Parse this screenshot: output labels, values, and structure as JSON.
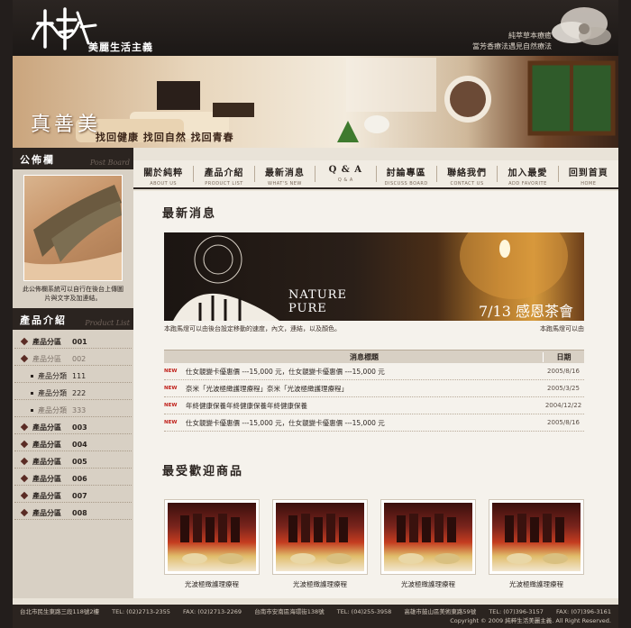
{
  "brand": {
    "logo_name": "純粹",
    "tagline": "美麗生活主義",
    "slogan_1": "純萃草本療癒",
    "slogan_2": "當芳香療法遇見自然療法"
  },
  "banner": {
    "title": "真善美",
    "subtitle": "找回健康 找回自然 找回青春"
  },
  "nav": [
    {
      "zh": "關於純粹",
      "en": "ABOUT US"
    },
    {
      "zh": "產品介紹",
      "en": "PRODUCT LIST"
    },
    {
      "zh": "最新消息",
      "en": "WHAT'S NEW"
    },
    {
      "zh": "Q & A",
      "en": "Q & A"
    },
    {
      "zh": "討論專區",
      "en": "DISCUSS BOARD"
    },
    {
      "zh": "聯絡我們",
      "en": "CONTACT US"
    },
    {
      "zh": "加入最愛",
      "en": "ADD FAVORITE"
    },
    {
      "zh": "回到首頁",
      "en": "HOME"
    }
  ],
  "sidebar": {
    "notice_title": "公佈欄",
    "notice_title_en": "Post Board",
    "notice_text": "此公佈欄系統可以自行在後台上傳圖片與文字及加連結。",
    "products_title": "產品介紹",
    "products_title_en": "Product List",
    "categories": [
      {
        "label": "產品分區",
        "num": "001",
        "type": "main"
      },
      {
        "label": "產品分區",
        "num": "002",
        "type": "dim"
      },
      {
        "label": "產品分類",
        "num": "111",
        "type": "sub"
      },
      {
        "label": "產品分類",
        "num": "222",
        "type": "sub"
      },
      {
        "label": "產品分類",
        "num": "333",
        "type": "subdim"
      },
      {
        "label": "產品分區",
        "num": "003",
        "type": "main"
      },
      {
        "label": "產品分區",
        "num": "004",
        "type": "main"
      },
      {
        "label": "產品分區",
        "num": "005",
        "type": "main"
      },
      {
        "label": "產品分區",
        "num": "006",
        "type": "main"
      },
      {
        "label": "產品分區",
        "num": "007",
        "type": "main"
      },
      {
        "label": "產品分區",
        "num": "008",
        "type": "main"
      }
    ]
  },
  "main": {
    "news_title": "最新消息",
    "promo_en_1": "NATURE",
    "promo_en_2": "PURE",
    "promo_zh": "7/13 感恩茶會",
    "marquee_left": "本跑馬燈可以由後台設定移動的速度，內文，連結，以及顏色。",
    "marquee_right": "本跑馬燈可以由",
    "table_head_title": "消息標題",
    "table_head_date": "日期",
    "new_badge": "NEW",
    "news": [
      {
        "title": "仕女靚變卡優惠價 ---15,000 元，仕女靚變卡優惠價 ---15,000 元",
        "date": "2005/8/16"
      },
      {
        "title": "奈米「光波極緻護理療程」奈米「光波極緻護理療程」",
        "date": "2005/3/25"
      },
      {
        "title": "年終健康保養年終健康保養年終健康保養",
        "date": "2004/12/22"
      },
      {
        "title": "仕女靚變卡優惠價 ---15,000 元，仕女靚變卡優惠價 ---15,000 元",
        "date": "2005/8/16"
      }
    ],
    "fav_title": "最受歡迎商品",
    "products": [
      {
        "name": "光波極緻護理療程"
      },
      {
        "name": "光波極緻護理療程"
      },
      {
        "name": "光波極緻護理療程"
      },
      {
        "name": "光波極緻護理療程"
      }
    ]
  },
  "footer": {
    "addr_1": "台北市民生東路三段118號2樓",
    "tel_1": "TEL: (02)2713-2355",
    "fax_1": "FAX: (02)2713-2269",
    "addr_2": "台南市安南區海環街138號",
    "tel_2": "TEL: (04)255-3958",
    "addr_3": "高雄市鼓山區美術東路59號",
    "tel_3": "TEL: (07)396-3157",
    "fax_3": "FAX: (07)396-3161",
    "copyright": "Copyright © 2009 純粹生活美麗主義. All Right Reserved."
  },
  "colors": {
    "dark": "#2b2420",
    "panel": "#d8d0c4",
    "content_bg": "#f5f2ec",
    "new_red": "#c0201a"
  }
}
